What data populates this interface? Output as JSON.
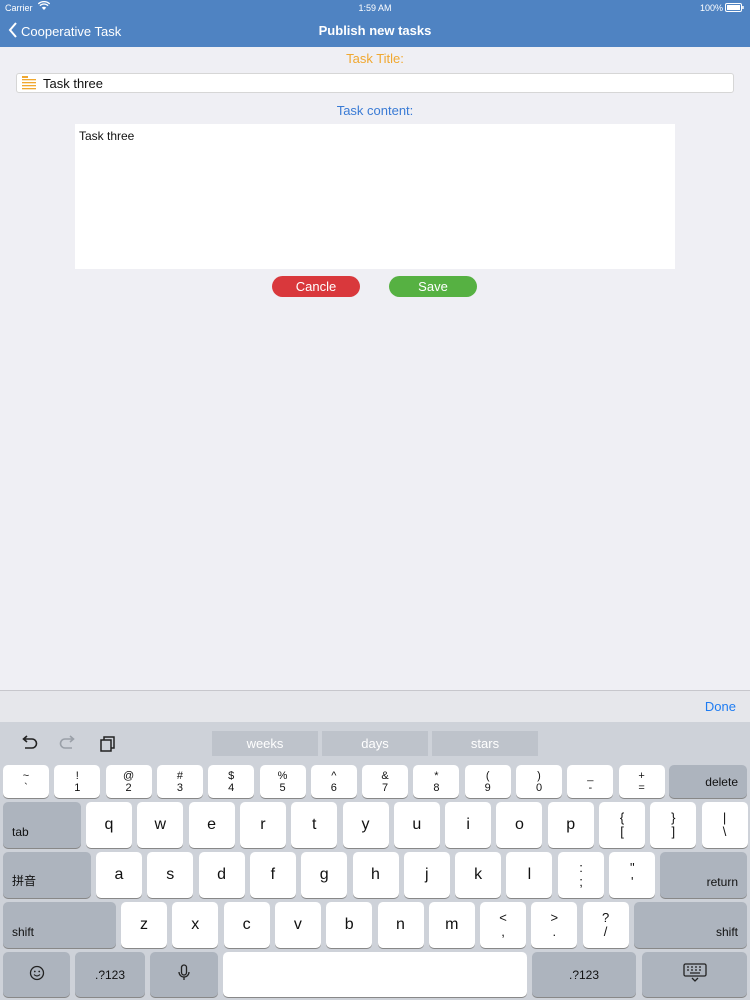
{
  "status_bar": {
    "carrier": "Carrier",
    "time": "1:59 AM",
    "battery": "100%"
  },
  "nav": {
    "back_label": "Cooperative Task",
    "title": "Publish new tasks"
  },
  "form": {
    "title_label": "Task Title:",
    "title_value": "Task three",
    "content_label": "Task content:",
    "content_value": "Task three",
    "cancel_label": "Cancle",
    "save_label": "Save",
    "colors": {
      "title_label": "#f0a830",
      "content_label": "#3a7bd5",
      "cancel": "#d9383c",
      "save": "#56b142",
      "nav": "#4f83c2"
    }
  },
  "keyboard": {
    "done_label": "Done",
    "suggestions": [
      "weeks",
      "days",
      "stars"
    ],
    "toolbar_icons": [
      "undo-icon",
      "redo-icon",
      "paste-icon"
    ],
    "number_row": [
      {
        "top": "~",
        "bottom": "`"
      },
      {
        "top": "!",
        "bottom": "1"
      },
      {
        "top": "@",
        "bottom": "2"
      },
      {
        "top": "#",
        "bottom": "3"
      },
      {
        "top": "$",
        "bottom": "4"
      },
      {
        "top": "%",
        "bottom": "5"
      },
      {
        "top": "^",
        "bottom": "6"
      },
      {
        "top": "&",
        "bottom": "7"
      },
      {
        "top": "*",
        "bottom": "8"
      },
      {
        "top": "(",
        "bottom": "9"
      },
      {
        "top": ")",
        "bottom": "0"
      },
      {
        "top": "_",
        "bottom": "-"
      },
      {
        "top": "+",
        "bottom": "="
      }
    ],
    "delete_label": "delete",
    "tab_label": "tab",
    "row_q": [
      "q",
      "w",
      "e",
      "r",
      "t",
      "y",
      "u",
      "i",
      "o",
      "p"
    ],
    "row_q_symbols": [
      {
        "top": "{",
        "bottom": "["
      },
      {
        "top": "}",
        "bottom": "]"
      },
      {
        "top": "|",
        "bottom": "\\"
      }
    ],
    "pinyin_label": "拼音",
    "row_a": [
      "a",
      "s",
      "d",
      "f",
      "g",
      "h",
      "j",
      "k",
      "l"
    ],
    "row_a_symbols": [
      {
        "top": ":",
        "bottom": ";"
      },
      {
        "top": "\"",
        "bottom": "'"
      }
    ],
    "return_label": "return",
    "shift_label": "shift",
    "row_z": [
      "z",
      "x",
      "c",
      "v",
      "b",
      "n",
      "m"
    ],
    "row_z_symbols": [
      {
        "top": "<",
        "bottom": ","
      },
      {
        "top": ">",
        "bottom": "."
      },
      {
        "top": "?",
        "bottom": "/"
      }
    ],
    "num_mode_label": ".?123"
  }
}
